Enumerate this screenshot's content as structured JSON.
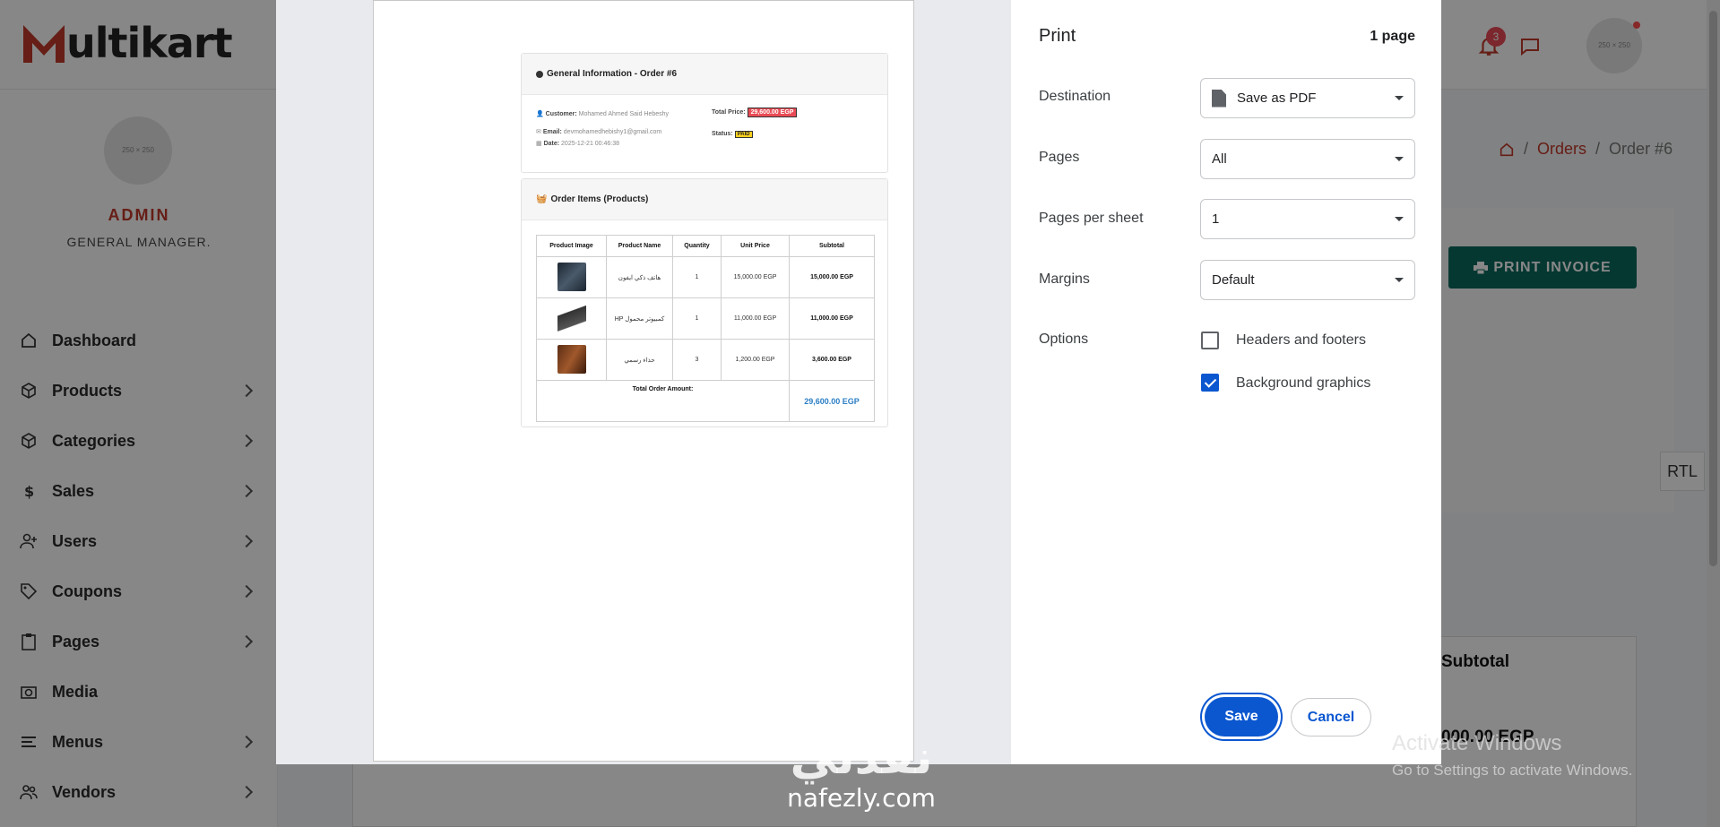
{
  "app": {
    "logo_text": "ultikart",
    "brand_color": "#c0392b"
  },
  "header": {
    "notifications_count": "3",
    "avatar_placeholder": "250 × 250"
  },
  "sidebar": {
    "avatar_placeholder": "250 × 250",
    "user_name": "ADMIN",
    "user_role": "GENERAL MANAGER.",
    "items": [
      {
        "label": "Dashboard",
        "icon": "home-icon"
      },
      {
        "label": "Products",
        "icon": "box-icon"
      },
      {
        "label": "Categories",
        "icon": "box-icon"
      },
      {
        "label": "Sales",
        "icon": "dollar-icon"
      },
      {
        "label": "Users",
        "icon": "user-plus-icon"
      },
      {
        "label": "Coupons",
        "icon": "tag-icon"
      },
      {
        "label": "Pages",
        "icon": "clipboard-icon"
      },
      {
        "label": "Media",
        "icon": "camera-icon"
      },
      {
        "label": "Menus",
        "icon": "menu-icon"
      },
      {
        "label": "Vendors",
        "icon": "users-icon"
      }
    ]
  },
  "breadcrumb": {
    "orders": "Orders",
    "current": "Order #6"
  },
  "actions": {
    "print_invoice": "PRINT INVOICE"
  },
  "background_table": {
    "subtotal_header": "Subtotal",
    "subtotal_value": "000.00 EGP"
  },
  "rtl_toggle": "RTL",
  "print_preview": {
    "general_title": "General Information - Order #6",
    "customer_label": "Customer:",
    "customer_value": "Mohamed Ahmed Said Hebeshy",
    "email_label": "Email:",
    "email_value": "devmohamedhebishy1@gmail.com",
    "date_label": "Date:",
    "date_value": "2025-12-21 00:46:38",
    "total_price_label": "Total Price:",
    "total_price_value": "29,600.00 EGP",
    "status_label": "Status:",
    "status_value": "PAID",
    "items_title": "Order Items (Products)",
    "columns": [
      "Product Image",
      "Product Name",
      "Quantity",
      "Unit Price",
      "Subtotal"
    ],
    "rows": [
      {
        "name": "هاتف ذكي ايفون",
        "qty": "1",
        "unit": "15,000.00 EGP",
        "subtotal": "15,000.00 EGP"
      },
      {
        "name": "HP كمبيوتر محمول",
        "qty": "1",
        "unit": "11,000.00 EGP",
        "subtotal": "11,000.00 EGP"
      },
      {
        "name": "حذاء رسمي",
        "qty": "3",
        "unit": "1,200.00 EGP",
        "subtotal": "3,600.00 EGP"
      }
    ],
    "total_label": "Total Order Amount:",
    "total_value": "29,600.00 EGP"
  },
  "print_dialog": {
    "title": "Print",
    "page_count": "1 page",
    "destination_label": "Destination",
    "destination_value": "Save as PDF",
    "pages_label": "Pages",
    "pages_value": "All",
    "pages_per_sheet_label": "Pages per sheet",
    "pages_per_sheet_value": "1",
    "margins_label": "Margins",
    "margins_value": "Default",
    "options_label": "Options",
    "headers_footers_label": "Headers and footers",
    "headers_footers_checked": false,
    "background_graphics_label": "Background graphics",
    "background_graphics_checked": true,
    "save_label": "Save",
    "cancel_label": "Cancel"
  },
  "windows_activation": {
    "line1": "Activate Windows",
    "line2": "Go to Settings to activate Windows."
  },
  "watermark": {
    "arabic": "نفذلي",
    "latin": "nafezly.com"
  }
}
